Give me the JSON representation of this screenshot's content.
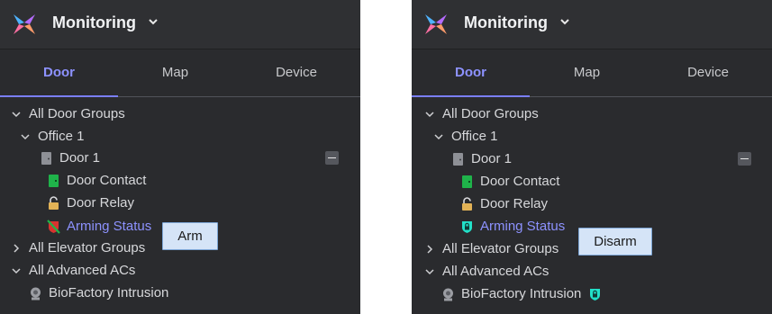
{
  "panels": [
    {
      "app_title": "Monitoring",
      "tabs": [
        "Door",
        "Map",
        "Device"
      ],
      "active_tab": "Door",
      "tree": {
        "all_door_groups": "All Door Groups",
        "office": "Office 1",
        "door": "Door 1",
        "door_contact": "Door Contact",
        "door_relay": "Door Relay",
        "arming_status": "Arming Status",
        "all_elevator_groups": "All Elevator Groups",
        "all_advanced_acs": "All Advanced ACs",
        "intrusion": "BioFactory Intrusion"
      },
      "arming_icon": "disarmed-shield-icon",
      "popup_label": "Arm"
    },
    {
      "app_title": "Monitoring",
      "tabs": [
        "Door",
        "Map",
        "Device"
      ],
      "active_tab": "Door",
      "tree": {
        "all_door_groups": "All Door Groups",
        "office": "Office 1",
        "door": "Door 1",
        "door_contact": "Door Contact",
        "door_relay": "Door Relay",
        "arming_status": "Arming Status",
        "all_elevator_groups": "All Elevator Groups",
        "all_advanced_acs": "All Advanced ACs",
        "intrusion": "BioFactory Intrusion"
      },
      "arming_icon": "armed-shield-icon",
      "intrusion_status_icon": "armed-shield-icon",
      "popup_label": "Disarm"
    }
  ],
  "colors": {
    "panel_bg": "#2a2b2e",
    "accent": "#8d92ff",
    "door_contact_green": "#1fb34a",
    "armed_cyan": "#22e0c8",
    "disarmed_red": "#d8332f",
    "tooltip_bg": "#d5e4f7"
  }
}
